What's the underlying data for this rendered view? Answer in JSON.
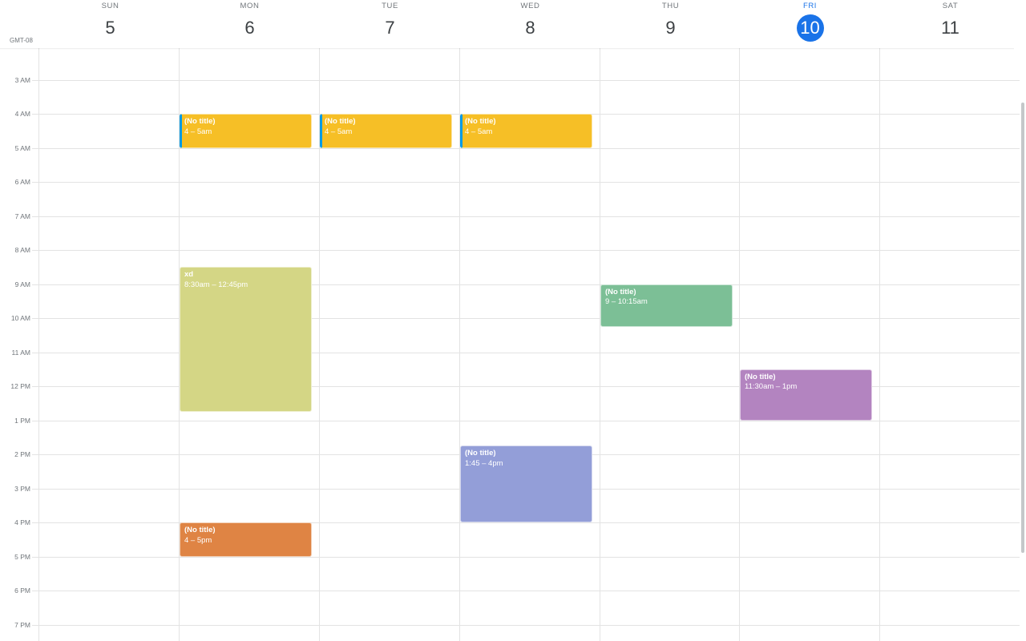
{
  "timezone": "GMT-08",
  "days": [
    {
      "name": "SUN",
      "num": "5",
      "today": false
    },
    {
      "name": "MON",
      "num": "6",
      "today": false
    },
    {
      "name": "TUE",
      "num": "7",
      "today": false
    },
    {
      "name": "WED",
      "num": "8",
      "today": false
    },
    {
      "name": "THU",
      "num": "9",
      "today": false
    },
    {
      "name": "FRI",
      "num": "10",
      "today": true
    },
    {
      "name": "SAT",
      "num": "11",
      "today": false
    }
  ],
  "hours": [
    "3 AM",
    "4 AM",
    "5 AM",
    "6 AM",
    "7 AM",
    "8 AM",
    "9 AM",
    "10 AM",
    "11 AM",
    "12 PM",
    "1 PM",
    "2 PM",
    "3 PM",
    "4 PM",
    "5 PM",
    "6 PM",
    "7 PM"
  ],
  "events": [
    {
      "day": 1,
      "start": 4,
      "end": 5,
      "title": "(No title)",
      "time": "4 – 5am",
      "color": "#f6bf26",
      "marked": true
    },
    {
      "day": 2,
      "start": 4,
      "end": 5,
      "title": "(No title)",
      "time": "4 – 5am",
      "color": "#f6bf26",
      "marked": true
    },
    {
      "day": 3,
      "start": 4,
      "end": 5,
      "title": "(No title)",
      "time": "4 – 5am",
      "color": "#f6bf26",
      "marked": true
    },
    {
      "day": 1,
      "start": 8.5,
      "end": 12.75,
      "title": "xd",
      "time": "8:30am – 12:45pm",
      "color": "#d4d685",
      "marked": false
    },
    {
      "day": 4,
      "start": 9,
      "end": 10.25,
      "title": "(No title)",
      "time": "9 – 10:15am",
      "color": "#7cbf96",
      "marked": false
    },
    {
      "day": 5,
      "start": 11.5,
      "end": 13,
      "title": "(No title)",
      "time": "11:30am – 1pm",
      "color": "#b384c0",
      "marked": false
    },
    {
      "day": 3,
      "start": 13.75,
      "end": 16,
      "title": "(No title)",
      "time": "1:45 – 4pm",
      "color": "#939ed8",
      "marked": false
    },
    {
      "day": 1,
      "start": 16,
      "end": 17,
      "title": "(No title)",
      "time": "4 – 5pm",
      "color": "#df8444",
      "marked": false
    }
  ]
}
